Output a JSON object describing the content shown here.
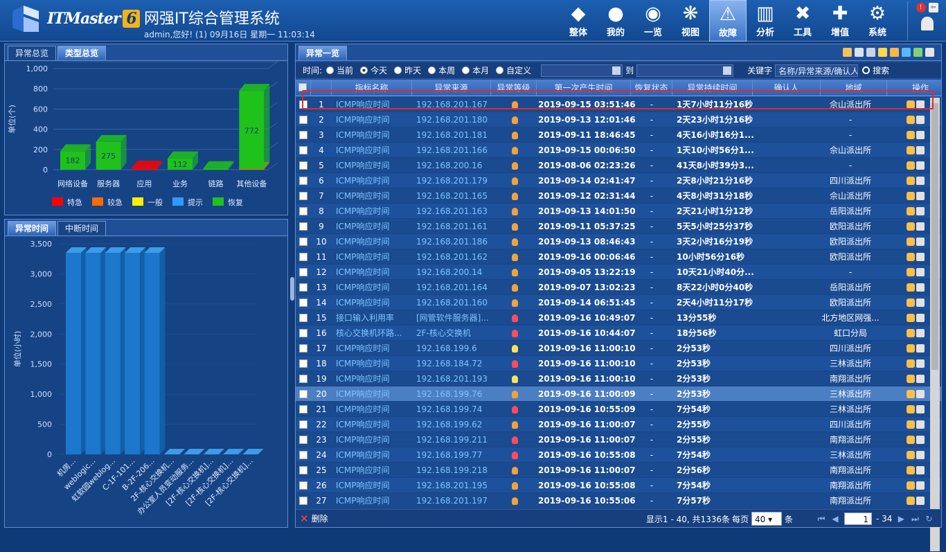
{
  "app": {
    "brand": "ITMaster",
    "version": "6",
    "title": "网强IT综合管理系统",
    "user_line": "admin,您好! (1) 09月16日 星期一 11:03:14"
  },
  "nav": [
    {
      "label": "整体",
      "icon": "layers-icon"
    },
    {
      "label": "我的",
      "icon": "user-icon"
    },
    {
      "label": "一览",
      "icon": "ball-icon"
    },
    {
      "label": "视图",
      "icon": "topology-icon"
    },
    {
      "label": "故障",
      "icon": "warning-icon",
      "active": true
    },
    {
      "label": "分析",
      "icon": "chart-icon"
    },
    {
      "label": "工具",
      "icon": "tools-icon"
    },
    {
      "label": "增值",
      "icon": "plus-icon"
    },
    {
      "label": "系统",
      "icon": "gear-icon"
    }
  ],
  "left_top": {
    "tabs": [
      "异常总览",
      "类型总览"
    ],
    "active_tab": 1
  },
  "left_bottom": {
    "tabs": [
      "异常时间",
      "中断时间"
    ],
    "active_tab": 0
  },
  "chart_data": [
    {
      "type": "bar",
      "ylabel": "单位(个)",
      "ylim": [
        0,
        1000
      ],
      "yticks": [
        "1,000",
        "800",
        "600",
        "400",
        "200",
        "0"
      ],
      "categories": [
        "网络设备",
        "服务器",
        "应用",
        "业务",
        "链路",
        "其他设备"
      ],
      "series": [
        {
          "name": "特急",
          "values": [
            0,
            0,
            20,
            0,
            0,
            0
          ],
          "color": "#ff0000"
        },
        {
          "name": "较急",
          "values": [
            0,
            0,
            0,
            0,
            0,
            8
          ],
          "color": "#ff6a00"
        },
        {
          "name": "一般",
          "values": [
            0,
            0,
            0,
            0,
            0,
            0
          ],
          "color": "#ffee00"
        },
        {
          "name": "提示",
          "values": [
            0,
            0,
            0,
            0,
            0,
            0
          ],
          "color": "#3399ff"
        },
        {
          "name": "恢复",
          "values": [
            182,
            275,
            0,
            112,
            15,
            772
          ],
          "color": "#1fc21a"
        }
      ],
      "data_labels": [
        "182",
        "275",
        "",
        "112",
        "",
        "772"
      ],
      "legend": "bottom"
    },
    {
      "type": "bar",
      "ylabel": "单位(小时)",
      "ylim": [
        0,
        3500
      ],
      "yticks": [
        "3,500",
        "3,000",
        "2,500",
        "2,000",
        "1,500",
        "1,000",
        "500",
        "0"
      ],
      "categories": [
        "机房...",
        "weblogic...",
        "虹软园weblog...",
        "C-1F-101...",
        "B-2F-206...",
        "2F-核心交换机...",
        "办公室人员变动服务...",
        "[2F-核心交换机]...",
        "[2F-核心交换机]...",
        "[2F-核心交换机]..."
      ],
      "series": [
        {
          "name": "",
          "values": [
            3350,
            3350,
            3350,
            3350,
            3350,
            0,
            0,
            0,
            0,
            0
          ],
          "color": "#1f7fd1"
        }
      ]
    }
  ],
  "right": {
    "tab": "异常一览",
    "filter": {
      "label": "时间:",
      "options": [
        "当前",
        "今天",
        "昨天",
        "本周",
        "本月",
        "自定义"
      ],
      "selected": 1,
      "to": "到",
      "keyword_label": "关键字",
      "keyword_value": "名称/异常来源/确认人",
      "search": "搜索"
    },
    "columns": [
      "指标名称",
      "异常来源",
      "异常等级",
      "第一次产生时间",
      "恢复状态",
      "异常持续时间",
      "确认人",
      "地域",
      "操作"
    ],
    "rows": [
      {
        "n": "1",
        "name": "ICMP响应时间",
        "src": "192.168.201.167",
        "lvl": "o",
        "t": "2019-09-15 03:51:46",
        "rec": "-",
        "dur": "1天7小时11分16秒",
        "area": "佘山派出所"
      },
      {
        "n": "2",
        "name": "ICMP响应时间",
        "src": "192.168.201.180",
        "lvl": "o",
        "t": "2019-09-13 12:01:46",
        "rec": "-",
        "dur": "2天23小时1分16秒",
        "area": "-"
      },
      {
        "n": "3",
        "name": "ICMP响应时间",
        "src": "192.168.201.181",
        "lvl": "o",
        "t": "2019-09-11 18:46:45",
        "rec": "-",
        "dur": "4天16小时16分1...",
        "area": "-"
      },
      {
        "n": "4",
        "name": "ICMP响应时间",
        "src": "192.168.201.166",
        "lvl": "o",
        "t": "2019-09-15 00:06:50",
        "rec": "-",
        "dur": "1天10小时56分1...",
        "area": "佘山派出所"
      },
      {
        "n": "5",
        "name": "ICMP响应时间",
        "src": "192.168.200.16",
        "lvl": "o",
        "t": "2019-08-06 02:23:26",
        "rec": "-",
        "dur": "41天8小时39分3...",
        "area": "-"
      },
      {
        "n": "6",
        "name": "ICMP响应时间",
        "src": "192.168.201.179",
        "lvl": "o",
        "t": "2019-09-14 02:41:47",
        "rec": "-",
        "dur": "2天8小时21分16秒",
        "area": "四川派出所"
      },
      {
        "n": "7",
        "name": "ICMP响应时间",
        "src": "192.168.201.165",
        "lvl": "o",
        "t": "2019-09-12 02:31:44",
        "rec": "-",
        "dur": "4天8小时31分18秒",
        "area": "佘山派出所"
      },
      {
        "n": "8",
        "name": "ICMP响应时间",
        "src": "192.168.201.163",
        "lvl": "o",
        "t": "2019-09-13 14:01:50",
        "rec": "-",
        "dur": "2天21小时1分12秒",
        "area": "岳阳派出所"
      },
      {
        "n": "9",
        "name": "ICMP响应时间",
        "src": "192.168.201.161",
        "lvl": "o",
        "t": "2019-09-11 05:37:25",
        "rec": "-",
        "dur": "5天5小时25分37秒",
        "area": "欧阳派出所"
      },
      {
        "n": "10",
        "name": "ICMP响应时间",
        "src": "192.168.201.186",
        "lvl": "o",
        "t": "2019-09-13 08:46:43",
        "rec": "-",
        "dur": "3天2小时16分19秒",
        "area": "欧阳派出所"
      },
      {
        "n": "11",
        "name": "ICMP响应时间",
        "src": "192.168.201.162",
        "lvl": "o",
        "t": "2019-09-16 00:06:46",
        "rec": "-",
        "dur": "10小时56分16秒",
        "area": "欧阳派出所"
      },
      {
        "n": "12",
        "name": "ICMP响应时间",
        "src": "192.168.200.14",
        "lvl": "o",
        "t": "2019-09-05 13:22:19",
        "rec": "-",
        "dur": "10天21小时40分...",
        "area": "-"
      },
      {
        "n": "13",
        "name": "ICMP响应时间",
        "src": "192.168.201.164",
        "lvl": "o",
        "t": "2019-09-07 13:02:23",
        "rec": "-",
        "dur": "8天22小时0分40秒",
        "area": "岳阳派出所"
      },
      {
        "n": "14",
        "name": "ICMP响应时间",
        "src": "192.168.201.160",
        "lvl": "o",
        "t": "2019-09-14 06:51:45",
        "rec": "-",
        "dur": "2天4小时11分17秒",
        "area": "欧阳派出所"
      },
      {
        "n": "15",
        "name": "接口输入利用率",
        "src": "[网管软件服务器]...",
        "lvl": "r",
        "t": "2019-09-16 10:49:07",
        "rec": "-",
        "dur": "13分55秒",
        "area": "北方地区网强..."
      },
      {
        "n": "16",
        "name": "核心交换机环路...",
        "src": "2F-核心交换机",
        "lvl": "r",
        "t": "2019-09-16 10:44:07",
        "rec": "-",
        "dur": "18分56秒",
        "area": "虹口分局"
      },
      {
        "n": "17",
        "name": "ICMP响应时间",
        "src": "192.168.199.6",
        "lvl": "y",
        "t": "2019-09-16 11:00:10",
        "rec": "-",
        "dur": "2分53秒",
        "area": "四川派出所"
      },
      {
        "n": "18",
        "name": "ICMP响应时间",
        "src": "192.168.184.72",
        "lvl": "r",
        "t": "2019-09-16 11:00:10",
        "rec": "-",
        "dur": "2分53秒",
        "area": "三林派出所"
      },
      {
        "n": "19",
        "name": "ICMP响应时间",
        "src": "192.168.201.193",
        "lvl": "y",
        "t": "2019-09-16 11:00:10",
        "rec": "-",
        "dur": "2分53秒",
        "area": "南翔派出所"
      },
      {
        "n": "20",
        "name": "ICMP响应时间",
        "src": "192.168.199.76",
        "lvl": "o",
        "t": "2019-09-16 11:00:09",
        "rec": "-",
        "dur": "2分53秒",
        "area": "三林派出所",
        "sel": true
      },
      {
        "n": "21",
        "name": "ICMP响应时间",
        "src": "192.168.199.74",
        "lvl": "r",
        "t": "2019-09-16 10:55:09",
        "rec": "-",
        "dur": "7分54秒",
        "area": "三林派出所"
      },
      {
        "n": "22",
        "name": "ICMP响应时间",
        "src": "192.168.199.62",
        "lvl": "o",
        "t": "2019-09-16 11:00:07",
        "rec": "-",
        "dur": "2分55秒",
        "area": "四川派出所"
      },
      {
        "n": "23",
        "name": "ICMP响应时间",
        "src": "192.168.199.211",
        "lvl": "r",
        "t": "2019-09-16 11:00:07",
        "rec": "-",
        "dur": "2分55秒",
        "area": "南翔派出所"
      },
      {
        "n": "24",
        "name": "ICMP响应时间",
        "src": "192.168.199.77",
        "lvl": "r",
        "t": "2019-09-16 10:55:08",
        "rec": "-",
        "dur": "7分54秒",
        "area": "三林派出所"
      },
      {
        "n": "25",
        "name": "ICMP响应时间",
        "src": "192.168.199.218",
        "lvl": "o",
        "t": "2019-09-16 11:00:07",
        "rec": "-",
        "dur": "2分56秒",
        "area": "南翔派出所"
      },
      {
        "n": "26",
        "name": "ICMP响应时间",
        "src": "192.168.201.195",
        "lvl": "o",
        "t": "2019-09-16 10:55:08",
        "rec": "-",
        "dur": "7分54秒",
        "area": "南翔派出所"
      },
      {
        "n": "27",
        "name": "ICMP响应时间",
        "src": "192.168.201.197",
        "lvl": "o",
        "t": "2019-09-16 10:55:06",
        "rec": "-",
        "dur": "7分57秒",
        "area": "南翔派出所"
      }
    ],
    "footer": {
      "delete": "删除",
      "info": "显示1 - 40, 共1336条",
      "per_page": "每页",
      "per_page_value": "40",
      "unit": "条",
      "page": "1",
      "total_pages": "- 34"
    }
  },
  "colors": {
    "bulb_orange": "#f3a23a",
    "bulb_red": "#ff4b5c",
    "bulb_yellow": "#ffe15a"
  }
}
